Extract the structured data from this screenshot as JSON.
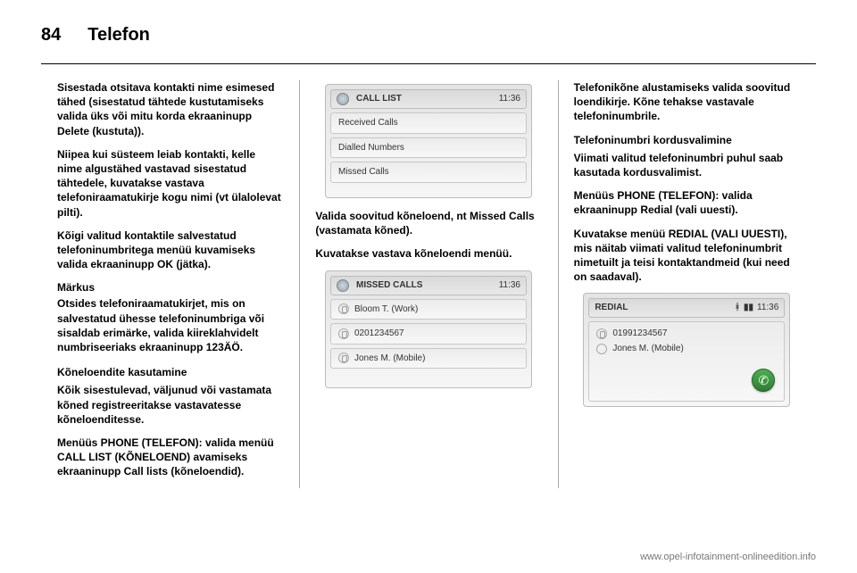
{
  "page_number": "84",
  "section": "Telefon",
  "col1": {
    "p1": "Sisestada otsitava kontakti nime esimesed tähed (sisestatud tähtede kustutamiseks valida üks või mitu korda ekraaninupp Delete (kustuta)).",
    "p2": "Niipea kui süsteem leiab kontakti, kelle nime algustähed vastavad sisestatud tähtedele, kuvatakse vastava telefoniraamatukirje kogu nimi (vt ülalolevat pilti).",
    "p3": "Kõigi valitud kontaktile salvestatud telefoninumbritega menüü kuvamiseks valida ekraaninupp OK (jätka).",
    "note_label": "Märkus",
    "note_body": "Otsides telefoniraamatukirjet, mis on salvestatud ühesse telefoninumbriga või sisaldab erimärke, valida kiireklahvidelt numbriseeriaks ekraaninupp 123ÄÖ.",
    "sub1": "Kõneloendite kasutamine",
    "p4": "Kõik sisestulevad, väljunud või vastamata kõned registreeritakse vastavatesse kõneloenditesse.",
    "p5": "Menüüs PHONE (TELEFON): valida menüü CALL LIST (KÕNELOEND) avamiseks ekraaninupp Call lists (kõneloendid)."
  },
  "col2": {
    "shot1": {
      "title": "CALL LIST",
      "time": "11:36",
      "rows": [
        "Received Calls",
        "Dialled Numbers",
        "Missed Calls"
      ]
    },
    "p1": "Valida soovitud kõneloend, nt Missed Calls (vastamata kõned).",
    "p2": "Kuvatakse vastava kõneloendi menüü.",
    "shot2": {
      "title": "MISSED CALLS",
      "time": "11:36",
      "rows": [
        "Bloom T. (Work)",
        "0201234567",
        "Jones M. (Mobile)"
      ]
    }
  },
  "col3": {
    "p1": "Telefonikõne alustamiseks valida soovitud loendikirje. Kõne tehakse vastavale telefoninumbrile.",
    "sub1": "Telefoninumbri kordusvalimine",
    "p2": "Viimati valitud telefoninumbri puhul saab kasutada kordusvalimist.",
    "p3": "Menüüs PHONE (TELEFON): valida ekraaninupp Redial (vali uuesti).",
    "p4": "Kuvatakse menüü REDIAL (VALI UUESTI), mis näitab viimati valitud telefoninumbrit nimetuilt ja teisi kontaktandmeid (kui need on saadaval).",
    "shot": {
      "title": "REDIAL",
      "time": "11:36",
      "number": "01991234567",
      "name": "Jones M. (Mobile)"
    }
  },
  "footer": "www.opel-infotainment-onlineedition.info"
}
